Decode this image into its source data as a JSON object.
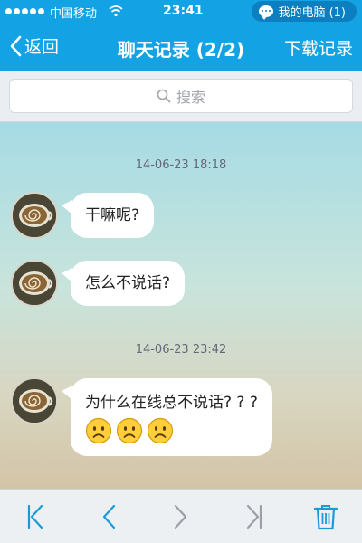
{
  "status_bar": {
    "carrier": "中国移动",
    "time": "23:41",
    "device_label": "我的电脑 (1)"
  },
  "nav": {
    "back_label": "返回",
    "title": "聊天记录 (2/2)",
    "download_label": "下载记录"
  },
  "search": {
    "placeholder": "搜索"
  },
  "messages": [
    {
      "timestamp": "14-06-23 18:18",
      "text": "干嘛呢?"
    },
    {
      "text": "怎么不说话?"
    },
    {
      "timestamp": "14-06-23 23:42",
      "text": "为什么在线总不说话? ? ?",
      "emoji": [
        "sad-face-icon",
        "sad-face-icon",
        "sad-face-icon"
      ]
    }
  ],
  "toolbar": {
    "icons": [
      "first-page-icon",
      "prev-page-icon",
      "next-page-icon",
      "last-page-icon",
      "trash-icon"
    ]
  },
  "colors": {
    "accent": "#13a2e3",
    "toolbar_icon": "#1b9ad6",
    "disabled_icon": "#9aa0a6"
  }
}
